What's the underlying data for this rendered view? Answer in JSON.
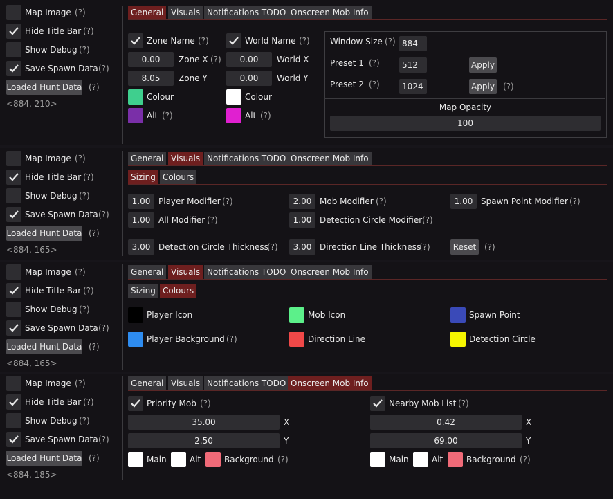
{
  "left_panel": {
    "map_image": "Map Image",
    "hide_title_bar": "Hide Title Bar",
    "show_debug": "Show Debug",
    "save_spawn_data": "Save Spawn Data",
    "loaded_hunt_data": "Loaded Hunt Data",
    "help": "(?)"
  },
  "coords": [
    "<884, 210>",
    "<884, 165>",
    "<884, 165>",
    "<884, 185>"
  ],
  "tabs": {
    "general": "General",
    "visuals": "Visuals",
    "notifications": "Notifications TODO",
    "onscreen": "Onscreen Mob Info"
  },
  "subtabs": {
    "sizing": "Sizing",
    "colours": "Colours"
  },
  "general": {
    "zone_name": "Zone Name",
    "world_name": "World Name",
    "zone_x_label": "Zone X",
    "zone_y_label": "Zone Y",
    "world_x_label": "World X",
    "world_y_label": "World Y",
    "zone_x": "0.00",
    "zone_y": "8.05",
    "world_x": "0.00",
    "world_y": "0.00",
    "colour": "Colour",
    "alt": "Alt",
    "window_size_label": "Window Size",
    "window_size": "884",
    "preset1_label": "Preset 1",
    "preset1": "512",
    "preset2_label": "Preset 2",
    "preset2": "1024",
    "apply": "Apply",
    "map_opacity_label": "Map Opacity",
    "map_opacity": "100",
    "colours": {
      "zone_colour": "#3fcf8e",
      "zone_alt": "#7a2fa8",
      "world_colour": "#ffffff",
      "world_alt": "#e020d0"
    }
  },
  "sizing": {
    "player_modifier_label": "Player Modifier",
    "player_modifier": "1.00",
    "mob_modifier_label": "Mob Modifier",
    "mob_modifier": "2.00",
    "spawn_point_modifier_label": "Spawn Point Modifier",
    "spawn_point_modifier": "1.00",
    "all_modifier_label": "All Modifier",
    "all_modifier": "1.00",
    "detection_circle_modifier_label": "Detection Circle Modifier",
    "detection_circle_modifier": "1.00",
    "detection_circle_thickness_label": "Detection Circle Thickness",
    "detection_circle_thickness": "3.00",
    "direction_line_thickness_label": "Direction Line Thickness",
    "direction_line_thickness": "3.00",
    "reset": "Reset"
  },
  "colours": {
    "player_icon": "Player Icon",
    "mob_icon": "Mob Icon",
    "spawn_point": "Spawn Point",
    "player_background": "Player Background",
    "direction_line": "Direction Line",
    "detection_circle": "Detection Circle",
    "values": {
      "player_icon": "#000000",
      "mob_icon": "#5cf08a",
      "spawn_point": "#3a4ab8",
      "player_background": "#2e8cf0",
      "direction_line": "#f04848",
      "detection_circle": "#f5f500"
    }
  },
  "onscreen": {
    "priority_mob": "Priority Mob",
    "nearby_mob_list": "Nearby Mob List",
    "priority_x": "35.00",
    "priority_y": "2.50",
    "nearby_x": "0.42",
    "nearby_y": "69.00",
    "x_label": "X",
    "y_label": "Y",
    "main": "Main",
    "alt": "Alt",
    "background": "Background",
    "colours": {
      "main": "#ffffff",
      "alt": "#ffffff",
      "background": "#f06a78"
    }
  }
}
